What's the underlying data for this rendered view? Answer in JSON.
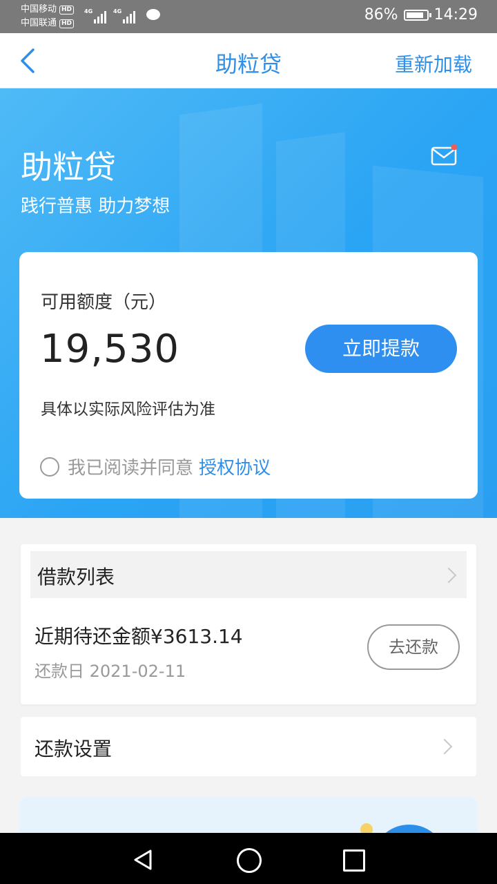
{
  "status_bar": {
    "carrier1": "中国移动",
    "carrier2": "中国联通",
    "hd": "HD",
    "network": "4G",
    "battery_percent": "86%",
    "battery_level": 0.86,
    "time": "14:29"
  },
  "nav": {
    "title": "助粒贷",
    "reload_label": "重新加载"
  },
  "hero": {
    "title": "助粒贷",
    "subtitle": "践行普惠 助力梦想"
  },
  "credit": {
    "label": "可用额度（元）",
    "amount": "19,530",
    "withdraw_label": "立即提款",
    "risk_note": "具体以实际风险评估为准",
    "agree_text": "我已阅读并同意",
    "agree_link": "授权协议"
  },
  "loan_list": {
    "title": "借款列表",
    "due_amount": "近期待还金额¥3613.14",
    "due_date": "还款日 2021-02-11",
    "repay_label": "去还款"
  },
  "repay_settings": {
    "label": "还款设置"
  },
  "colors": {
    "accent": "#2f8fe8",
    "hero_start": "#4fbaf6",
    "hero_end": "#2a9ff1",
    "notification": "#f25c54"
  }
}
